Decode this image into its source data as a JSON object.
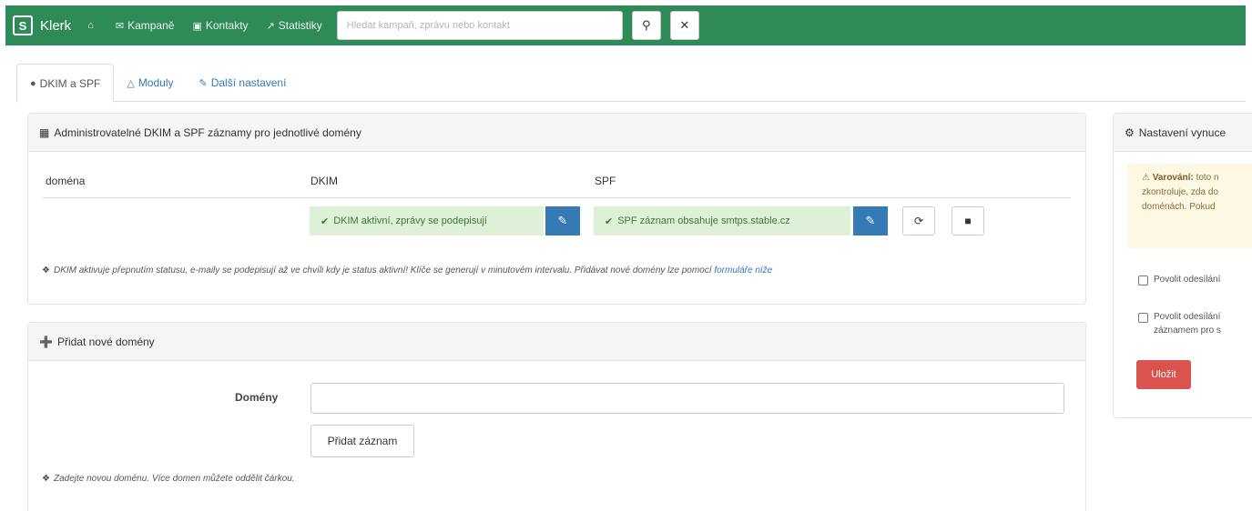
{
  "navbar": {
    "brand_logo": "S",
    "brand_name": "Klerk",
    "home_icon": "home-icon",
    "items": [
      {
        "icon": "envelope-icon",
        "label": "Kampaně"
      },
      {
        "icon": "address-book-icon",
        "label": "Kontakty"
      },
      {
        "icon": "line-chart-icon",
        "label": "Statistiky"
      }
    ],
    "search_placeholder": "Hledat kampaň, zprávu nebo kontakt",
    "search_icon": "search-icon",
    "close_icon": "close-icon",
    "color": "#2e8b57"
  },
  "tabs": [
    {
      "icon": "circle-icon",
      "label": "DKIM a SPF",
      "active": true
    },
    {
      "icon": "flask-icon",
      "label": "Moduly",
      "active": false
    },
    {
      "icon": "wrench-icon",
      "label": "Další nastavení",
      "active": false
    }
  ],
  "dkim_panel": {
    "title": "Administrovatelné DKIM a SPF záznamy pro jednotlivé domény",
    "columns": {
      "domain": "doména",
      "dkim": "DKIM",
      "spf": "SPF"
    },
    "row": {
      "domain": "",
      "dkim_status": "DKIM aktivní, zprávy se podepisují",
      "spf_status": "SPF záznam obsahuje smtps.stable.cz"
    },
    "note": "DKIM aktivuje přepnutím statusu, e-maily se podepisují až ve chvíli kdy je status aktivní! Klíče se generují v minutovém intervalu. Přidávat nové domény lze pomocí",
    "note_link": "formuláře níže"
  },
  "add_panel": {
    "title": "Přidat nové domény",
    "label": "Domény",
    "input_value": "",
    "button": "Přidat záznam",
    "note": "Zadejte novou doménu. Více domen můžete oddělit čárkou."
  },
  "side_panel": {
    "title": "Nastavení vynuce",
    "warning_title": "Varování:",
    "warning_lines": [
      "toto n",
      "zkontroluje, zda do",
      "doménách. Pokud"
    ],
    "checkbox1": "Povolit odesílání",
    "checkbox2_line1": "Povolit odesílání",
    "checkbox2_line2": "záznamem pro s",
    "save_button": "Uložit"
  },
  "colors": {
    "accent": "#337ab7",
    "success_bg": "#dff0d8",
    "success_text": "#3c763d",
    "warning_bg": "#fcf8e3",
    "danger": "#d9534f"
  }
}
